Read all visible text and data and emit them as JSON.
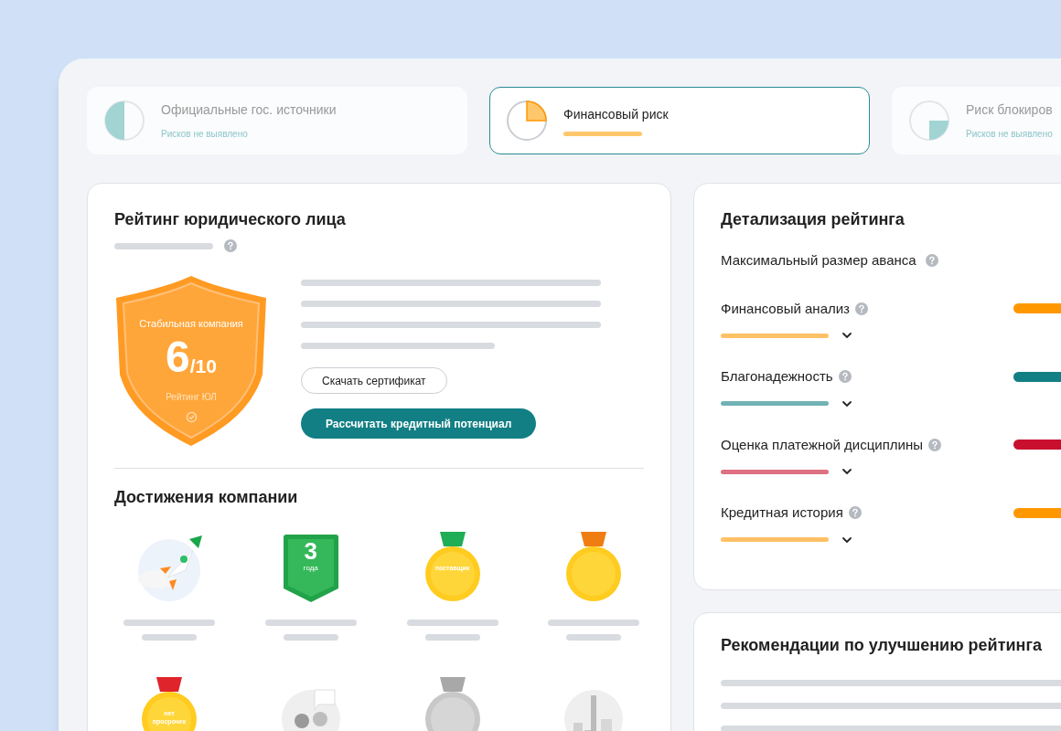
{
  "risk_cards": [
    {
      "kind": "text",
      "title": "Официальные гос. источники",
      "subtitle": "Рисков не выявлено",
      "selected": false
    },
    {
      "kind": "bar",
      "title": "Финансовый риск",
      "selected": true
    },
    {
      "kind": "text",
      "title": "Риск блокиров",
      "subtitle": "Рисков не выявлено",
      "selected": false
    }
  ],
  "rating": {
    "title": "Рейтинг юридического лица",
    "caption": "Стабильная компания",
    "score": "6",
    "scale": "/10",
    "label": "Рейтинг ЮЛ",
    "buttons": [
      {
        "kind": "outline",
        "label": "Скачать сертификат"
      },
      {
        "kind": "primary",
        "label": "Рассчитать кредитный потенциал"
      }
    ]
  },
  "achievements": {
    "title": "Достижения компании",
    "items": [
      {
        "kind": "rocket"
      },
      {
        "kind": "years",
        "number": "3",
        "caption": "года"
      },
      {
        "kind": "medal",
        "color": "#1fae55",
        "text": "поставщик"
      },
      {
        "kind": "medal",
        "color": "#f07d12"
      },
      {
        "kind": "medal",
        "color": "#e0242c",
        "text": "нет просрочек"
      },
      {
        "kind": "people"
      },
      {
        "kind": "medal",
        "color": "#a8a8a8"
      },
      {
        "kind": "city"
      }
    ]
  },
  "details": {
    "title": "Детализация рейтинга",
    "advance": "Максимальный размер аванса",
    "items": [
      {
        "name": "Финансовый анализ",
        "color": "#ff9800",
        "expanded": false
      },
      {
        "name": "Благонадежность",
        "color": "#127f84",
        "expanded": false
      },
      {
        "name": "Оценка платежной дисциплины",
        "color": "#c8102e",
        "expanded": false
      },
      {
        "name": "Кредитная история",
        "color": "#ff9800",
        "expanded": false
      }
    ]
  },
  "recommendations": {
    "title": "Рекомендации по улучшению рейтинга"
  }
}
